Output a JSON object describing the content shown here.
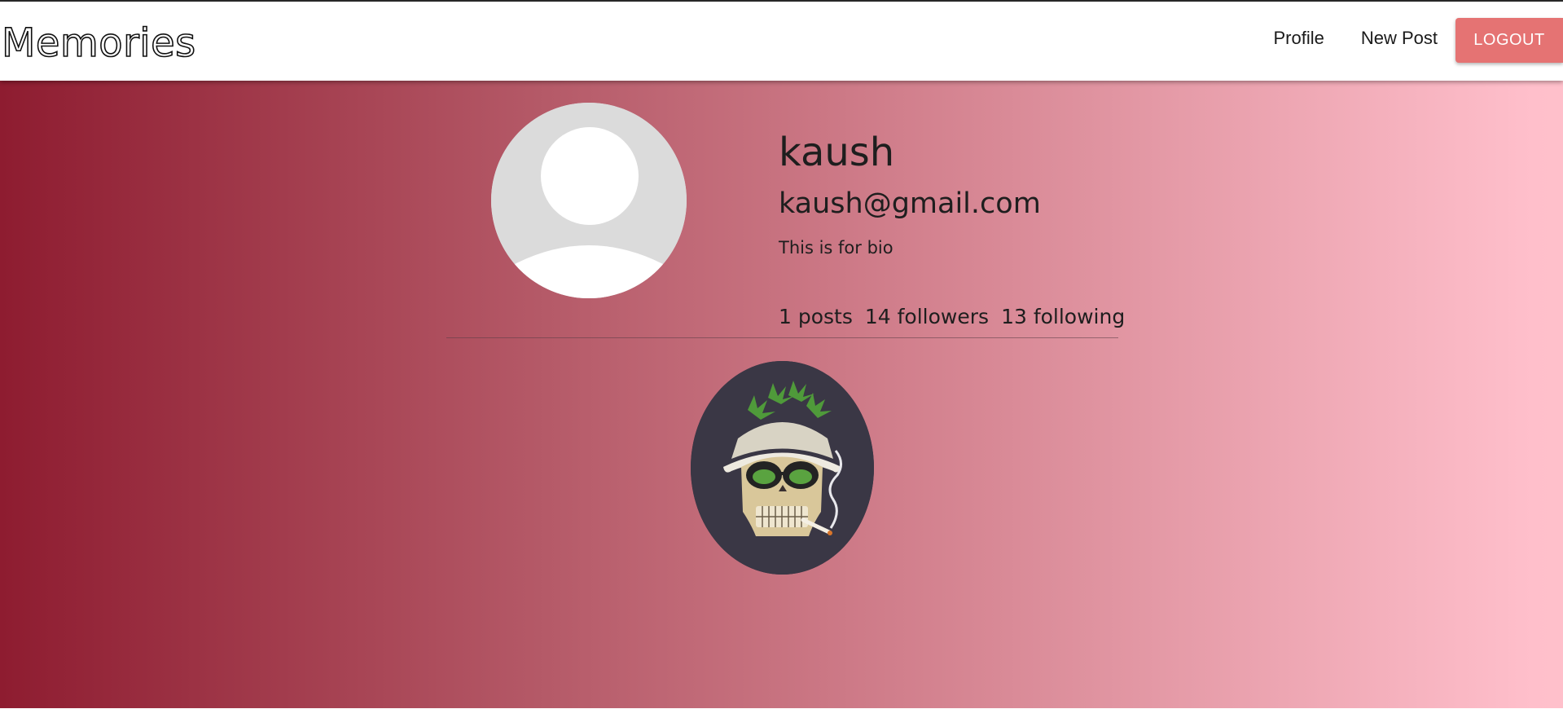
{
  "navbar": {
    "brand": "Memories",
    "links": {
      "profile": "Profile",
      "new_post": "New Post"
    },
    "logout_label": "LOGOUT"
  },
  "profile": {
    "avatar_icon": "default-user-avatar",
    "username": "kaush",
    "email": "kaush@gmail.com",
    "bio": "This is for bio",
    "stats": {
      "posts": "1 posts",
      "followers": "14 followers",
      "following": "13 following"
    }
  },
  "posts": [
    {
      "image_icon": "skull-with-hat-and-sunglasses"
    }
  ],
  "colors": {
    "logout_button": "#e57373",
    "gradient_start": "#8e1c30",
    "gradient_end": "#ffc0cb",
    "avatar_bg": "#dbdbdb",
    "post_bg": "#3a3745"
  }
}
